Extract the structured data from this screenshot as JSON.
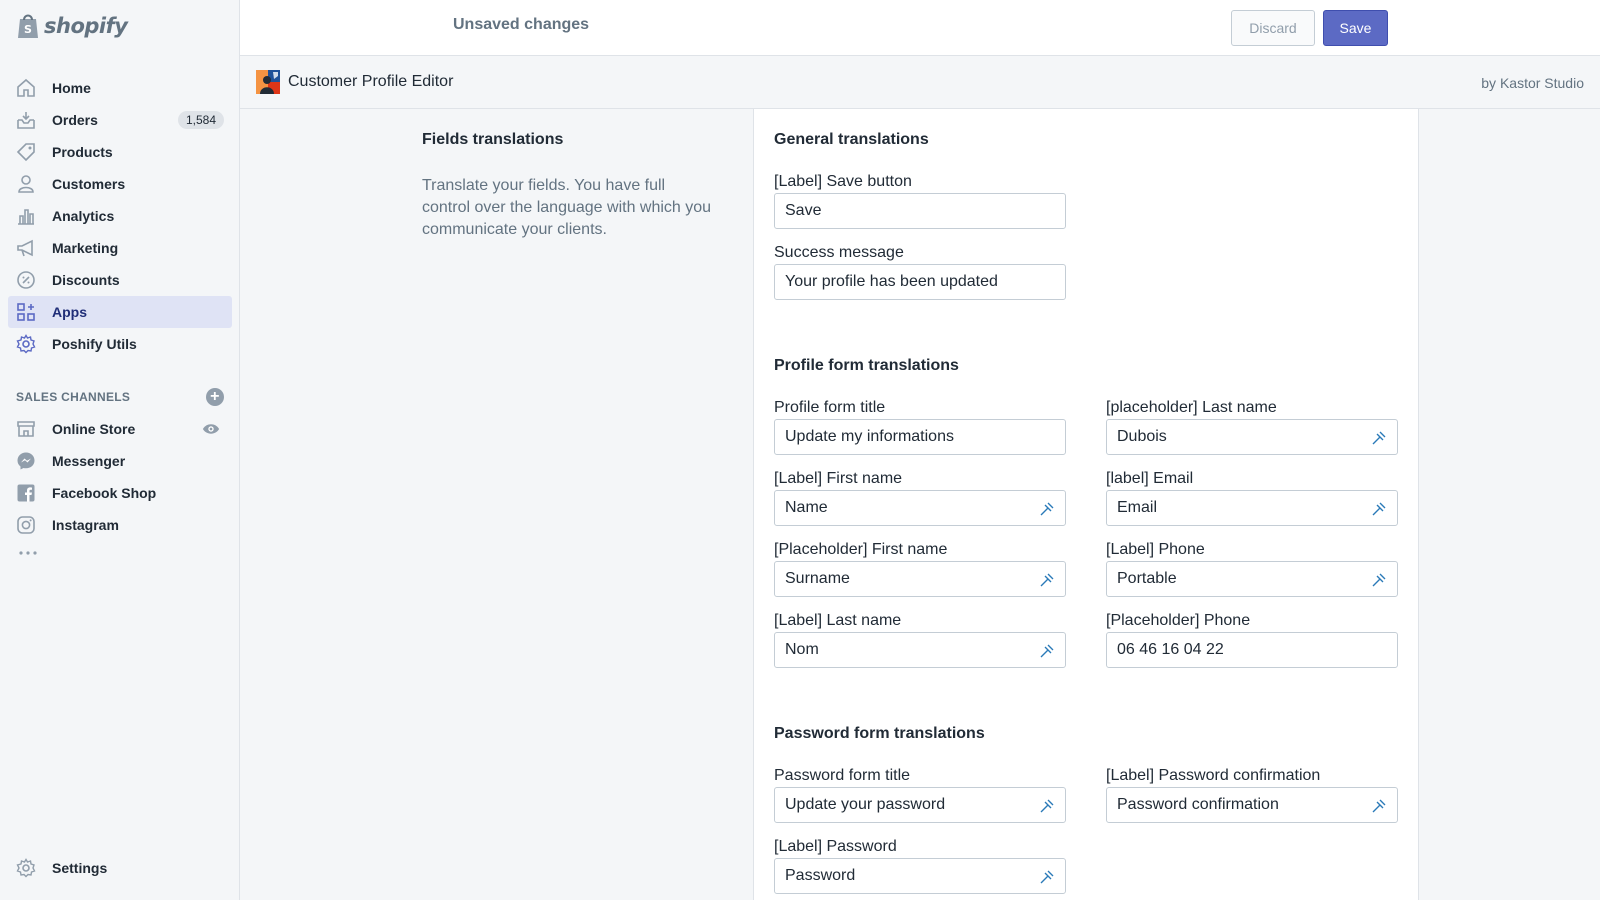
{
  "brand": {
    "logo_text": "shopify"
  },
  "sidebar": {
    "items": [
      {
        "label": "Home",
        "icon": "home-icon"
      },
      {
        "label": "Orders",
        "icon": "orders-icon",
        "badge": "1,584"
      },
      {
        "label": "Products",
        "icon": "tag-icon"
      },
      {
        "label": "Customers",
        "icon": "person-icon"
      },
      {
        "label": "Analytics",
        "icon": "chart-icon"
      },
      {
        "label": "Marketing",
        "icon": "megaphone-icon"
      },
      {
        "label": "Discounts",
        "icon": "discount-icon"
      },
      {
        "label": "Apps",
        "icon": "apps-icon",
        "active": true
      },
      {
        "label": "Poshify Utils",
        "icon": "gear-icon"
      }
    ],
    "sales_channels_heading": "SALES CHANNELS",
    "channels": [
      {
        "label": "Online Store",
        "icon": "store-icon"
      },
      {
        "label": "Messenger",
        "icon": "messenger-icon"
      },
      {
        "label": "Facebook Shop",
        "icon": "facebook-icon"
      },
      {
        "label": "Instagram",
        "icon": "instagram-icon"
      }
    ],
    "settings_label": "Settings"
  },
  "topbar": {
    "status": "Unsaved changes",
    "discard_label": "Discard",
    "save_label": "Save"
  },
  "app": {
    "title": "Customer Profile Editor",
    "by": "by Kastor Studio"
  },
  "fields_translations": {
    "title": "Fields translations",
    "description": "Translate your fields. You have full control over the language with which you communicate your clients."
  },
  "general": {
    "title": "General translations",
    "save_button": {
      "label": "[Label] Save button",
      "value": "Save"
    },
    "success_message": {
      "label": "Success message",
      "value": "Your profile has been updated"
    }
  },
  "profile": {
    "title": "Profile form translations",
    "form_title": {
      "label": "Profile form title",
      "value": "Update my informations"
    },
    "first_name_label": {
      "label": "[Label] First name",
      "value": "Name"
    },
    "first_name_placeholder": {
      "label": "[Placeholder] First name",
      "value": "Surname"
    },
    "last_name_label": {
      "label": "[Label] Last name",
      "value": "Nom"
    },
    "last_name_placeholder": {
      "label": "[placeholder] Last name",
      "value": "Dubois"
    },
    "email_label": {
      "label": "[label] Email",
      "value": "Email"
    },
    "phone_label": {
      "label": "[Label] Phone",
      "value": "Portable"
    },
    "phone_placeholder": {
      "label": "[Placeholder] Phone",
      "value": "06 46 16 04 22"
    }
  },
  "password": {
    "title": "Password form translations",
    "form_title": {
      "label": "Password form title",
      "value": "Update your password"
    },
    "password_label": {
      "label": "[Label] Password",
      "value": "Password"
    },
    "confirmation_label": {
      "label": "[Label] Password confirmation",
      "value": "Password confirmation"
    }
  },
  "colors": {
    "accent": "#5c6ac4",
    "active_nav_bg": "#dfe3f5",
    "translate_icon": "#2a7ab8"
  }
}
